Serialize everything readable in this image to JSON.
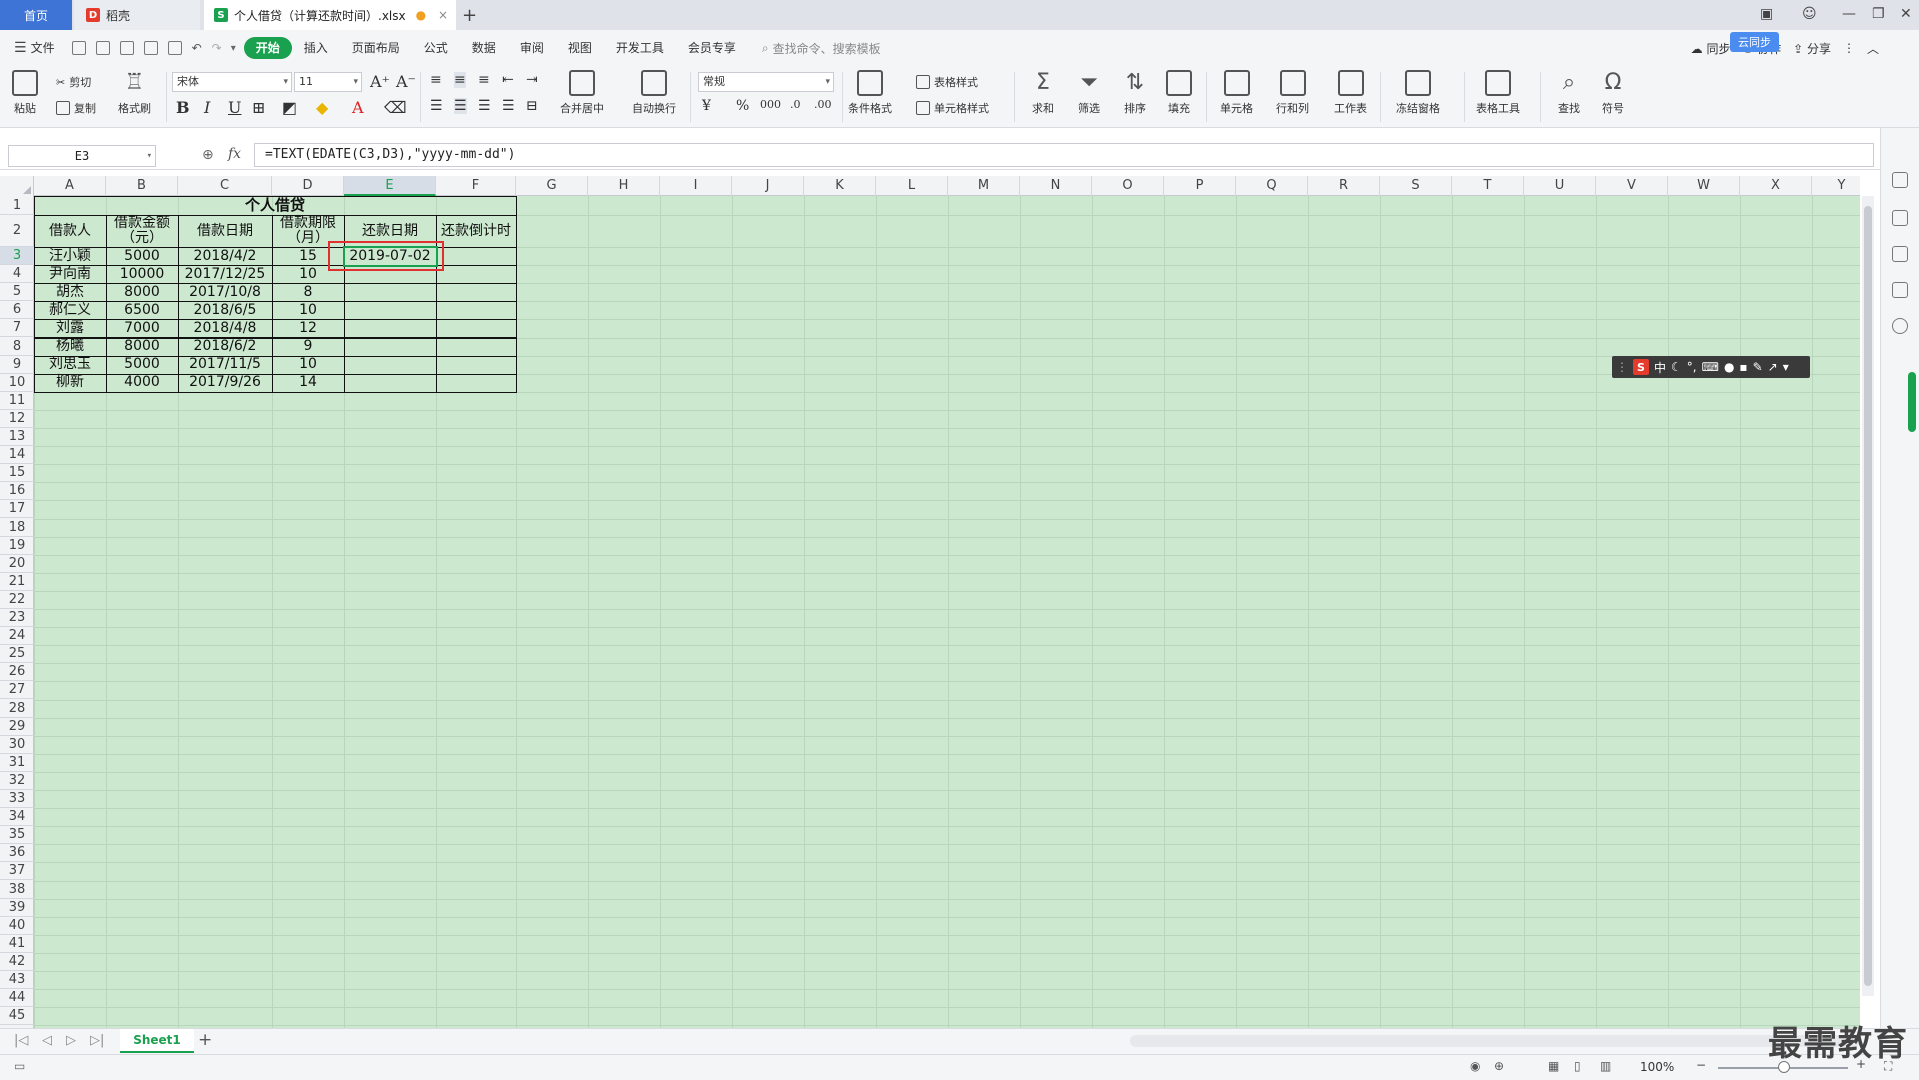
{
  "tabs": {
    "home": "首页",
    "daoke": "稻壳",
    "file": "个人借贷（计算还款时间）.xlsx"
  },
  "menu": {
    "file": "文件",
    "items": [
      "开始",
      "插入",
      "页面布局",
      "公式",
      "数据",
      "审阅",
      "视图",
      "开发工具",
      "会员专享"
    ],
    "search_placeholder": "查找命令、搜索模板",
    "cloud_badge": "云同步",
    "sync": "同步",
    "collab": "协作",
    "share": "分享"
  },
  "ribbon": {
    "paste": "粘贴",
    "cut": "剪切",
    "copy": "复制",
    "format_painter": "格式刷",
    "font_name": "宋体",
    "font_size": "11",
    "merge_center": "合并居中",
    "wrap_text": "自动换行",
    "number_format": "常规",
    "conditional_format": "条件格式",
    "table_style": "表格样式",
    "cell_style": "单元格样式",
    "sum": "求和",
    "filter": "筛选",
    "sort": "排序",
    "fill": "填充",
    "cell": "单元格",
    "row_col": "行和列",
    "worksheet": "工作表",
    "freeze": "冻结窗格",
    "table_tools": "表格工具",
    "find": "查找",
    "symbol": "符号"
  },
  "formula_bar": {
    "name_box": "E3",
    "fx": "fx",
    "formula": "=TEXT(EDATE(C3,D3),\"yyyy-mm-dd\")"
  },
  "columns": [
    "A",
    "B",
    "C",
    "D",
    "E",
    "F",
    "G",
    "H",
    "I",
    "J",
    "K",
    "L",
    "M",
    "N",
    "O",
    "P",
    "Q",
    "R",
    "S",
    "T",
    "U",
    "V",
    "W",
    "X",
    "Y"
  ],
  "selected_column": "E",
  "selected_row": 3,
  "rows": [
    "1",
    "2",
    "3",
    "4",
    "5",
    "6",
    "7",
    "8",
    "9",
    "10",
    "11",
    "12",
    "13",
    "14",
    "15",
    "16",
    "17",
    "18",
    "19",
    "20",
    "21",
    "22",
    "23",
    "24",
    "25",
    "26",
    "27",
    "28",
    "29",
    "30",
    "31",
    "32",
    "33",
    "34",
    "35",
    "36",
    "37",
    "38",
    "39",
    "40",
    "41",
    "42",
    "43",
    "44",
    "45"
  ],
  "sheet": {
    "title": "个人借贷",
    "headers": [
      "借款人",
      "借款金额（元）",
      "借款日期",
      "借款期限（月）",
      "还款日期",
      "还款倒计时"
    ],
    "data": [
      [
        "汪小颖",
        "5000",
        "2018/4/2",
        "15",
        "2019-07-02",
        ""
      ],
      [
        "尹向南",
        "10000",
        "2017/12/25",
        "10",
        "",
        ""
      ],
      [
        "胡杰",
        "8000",
        "2017/10/8",
        "8",
        "",
        ""
      ],
      [
        "郝仁义",
        "6500",
        "2018/6/5",
        "10",
        "",
        ""
      ],
      [
        "刘露",
        "7000",
        "2018/4/8",
        "12",
        "",
        ""
      ],
      [
        "杨曦",
        "8000",
        "2018/6/2",
        "9",
        "",
        ""
      ],
      [
        "刘思玉",
        "5000",
        "2017/11/5",
        "10",
        "",
        ""
      ],
      [
        "柳新",
        "4000",
        "2017/9/26",
        "14",
        "",
        ""
      ]
    ]
  },
  "ime": {
    "mode": "中"
  },
  "sheet_tabs": [
    "Sheet1"
  ],
  "status": {
    "zoom": "100%"
  },
  "watermark": "最需教育"
}
